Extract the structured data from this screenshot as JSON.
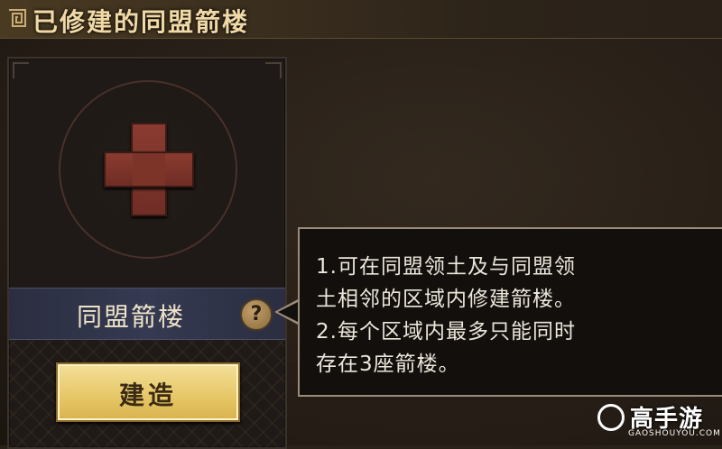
{
  "header": {
    "title": "已修建的同盟箭楼"
  },
  "card": {
    "add_slot_icon": "plus-icon",
    "name": "同盟箭楼",
    "help_label": "?",
    "build_label": "建造"
  },
  "tooltip": {
    "lines": [
      "1.可在同盟领土及与同盟领",
      "土相邻的区域内修建箭楼。",
      "2.每个区域内最多只能同时",
      "存在3座箭楼。"
    ]
  },
  "watermark": {
    "brand": "G",
    "text": "高手游",
    "subtext": "GAOSHOUYOU.COM"
  },
  "colors": {
    "title_text": "#f0d9a6",
    "plus_red": "#7c3429",
    "build_button": "#e6c665",
    "tooltip_bg": "#120f0d",
    "tooltip_border": "#9a8c78"
  }
}
